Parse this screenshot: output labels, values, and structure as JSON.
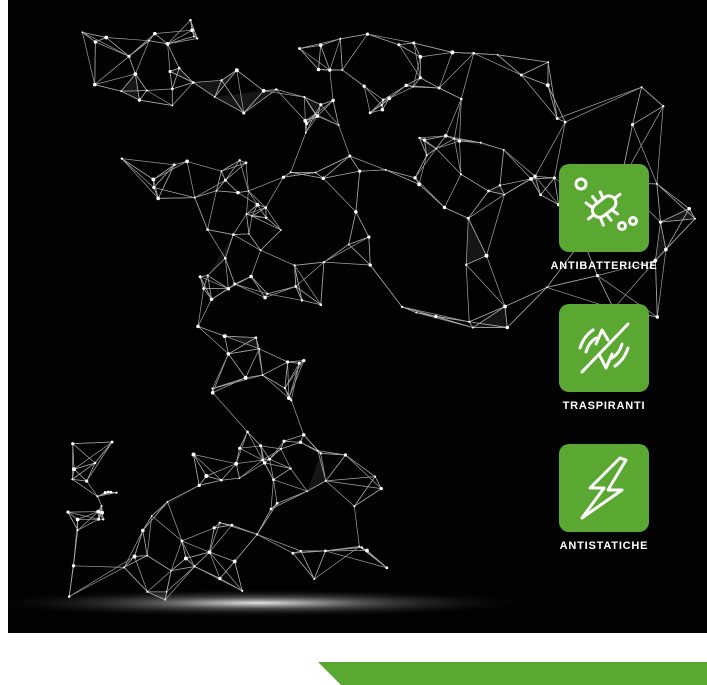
{
  "badges": [
    {
      "label": "ANTIBATTERICHE",
      "icon": "bacteria-icon"
    },
    {
      "label": "TRASPIRANTI",
      "icon": "breathable-arrows-icon"
    },
    {
      "label": "ANTISTATICHE",
      "icon": "lightning-bolt-icon"
    }
  ],
  "colors": {
    "accent_green": "#5aa832",
    "background": "#020202",
    "mesh": "#d8d8d8"
  }
}
